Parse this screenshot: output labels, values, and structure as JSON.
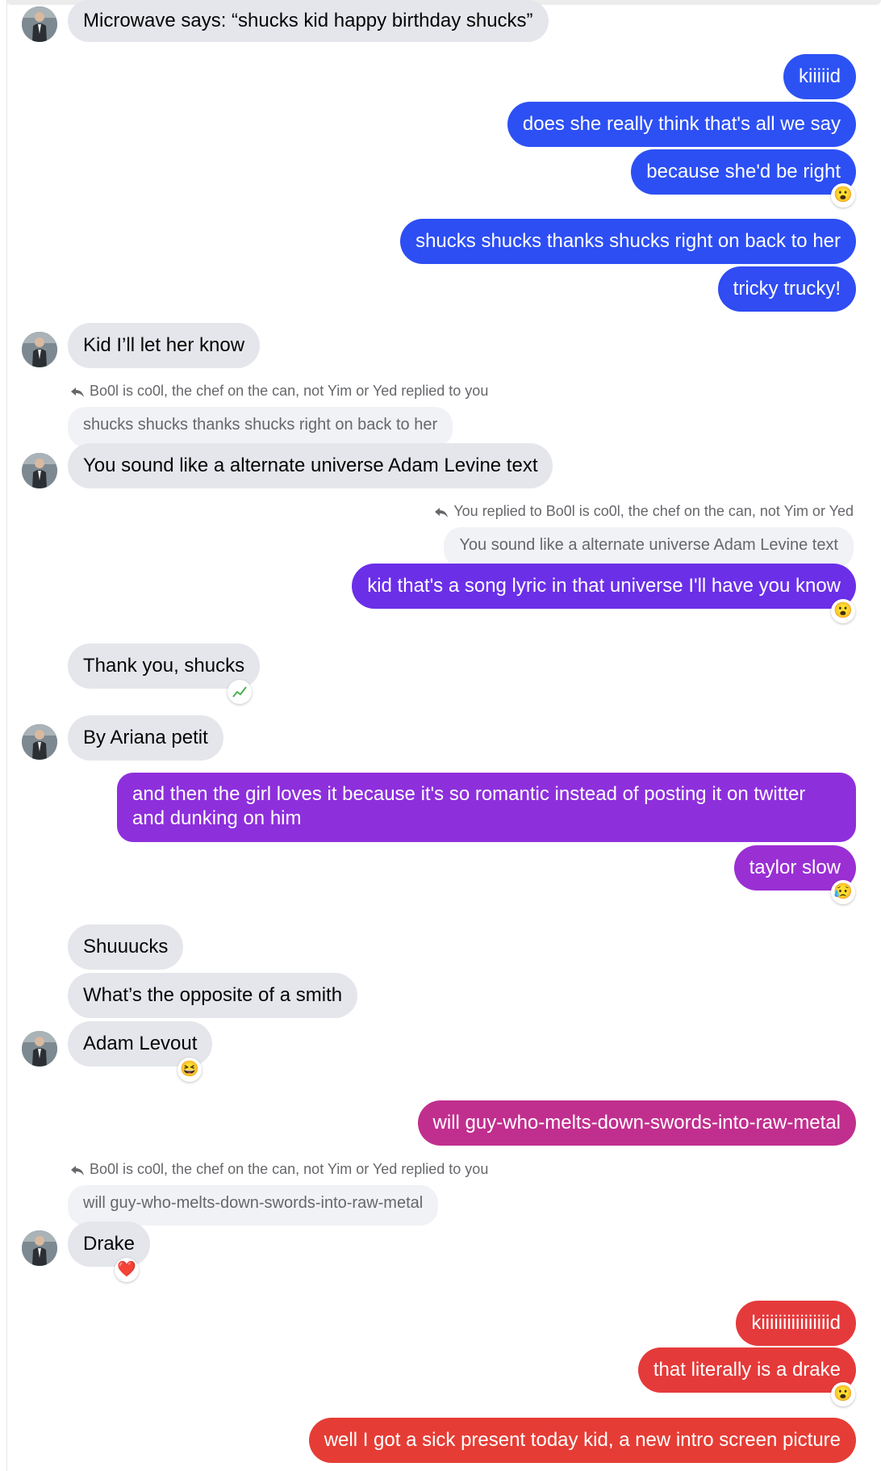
{
  "colors": {
    "incoming_bubble": "#e4e6eb",
    "gradient_blue": "#2d52f4",
    "gradient_indigo": "#6b2fe8",
    "gradient_purple": "#8e2fdc",
    "gradient_magenta": "#c12f8e",
    "gradient_red": "#e53935"
  },
  "contact": {
    "name": "Bo0l is co0l, the chef on the can, not Yim or Yed",
    "avatar_icon": "contact-avatar"
  },
  "messages": [
    {
      "text": "Microwave says: “shucks kid happy birthday shucks”"
    },
    {
      "text": "kiiiiid"
    },
    {
      "text": "does she really think that's all we say"
    },
    {
      "text": "because she'd be right",
      "reaction": "😮"
    },
    {
      "text": "shucks shucks thanks shucks right on back to her"
    },
    {
      "text": "tricky trucky!"
    },
    {
      "text": "Kid I’ll let her know"
    },
    {
      "reply_meta": "Bo0l is co0l, the chef on the can, not Yim or Yed replied to you",
      "quote": "shucks shucks thanks shucks right on back to her",
      "text": "You sound like a alternate universe Adam Levine text"
    },
    {
      "reply_meta": "You replied to Bo0l is co0l, the chef on the can, not Yim or Yed",
      "quote": "You sound like a alternate universe Adam Levine text",
      "text": "kid that's a song lyric in that universe I'll have you know",
      "reaction": "😮"
    },
    {
      "text": "Thank you, shucks",
      "reaction": "chart-increasing-icon"
    },
    {
      "text": "By Ariana petit"
    },
    {
      "text": "and then the girl loves it because it's so romantic instead of posting it on twitter and dunking on him"
    },
    {
      "text": "taylor slow",
      "reaction": "😥"
    },
    {
      "text": "Shuuucks"
    },
    {
      "text": "What’s the opposite of a smith"
    },
    {
      "text": "Adam Levout",
      "reaction": "😆"
    },
    {
      "text": "will guy-who-melts-down-swords-into-raw-metal"
    },
    {
      "reply_meta": "Bo0l is co0l, the chef on the can, not Yim or Yed replied to you",
      "quote": "will guy-who-melts-down-swords-into-raw-metal",
      "text": "Drake",
      "reaction": "❤️"
    },
    {
      "text": "kiiiiiiiiiiiiiiiid"
    },
    {
      "text": "that literally is a drake",
      "reaction": "😮"
    },
    {
      "text": "well I got a sick present today kid, a new intro screen picture"
    }
  ]
}
